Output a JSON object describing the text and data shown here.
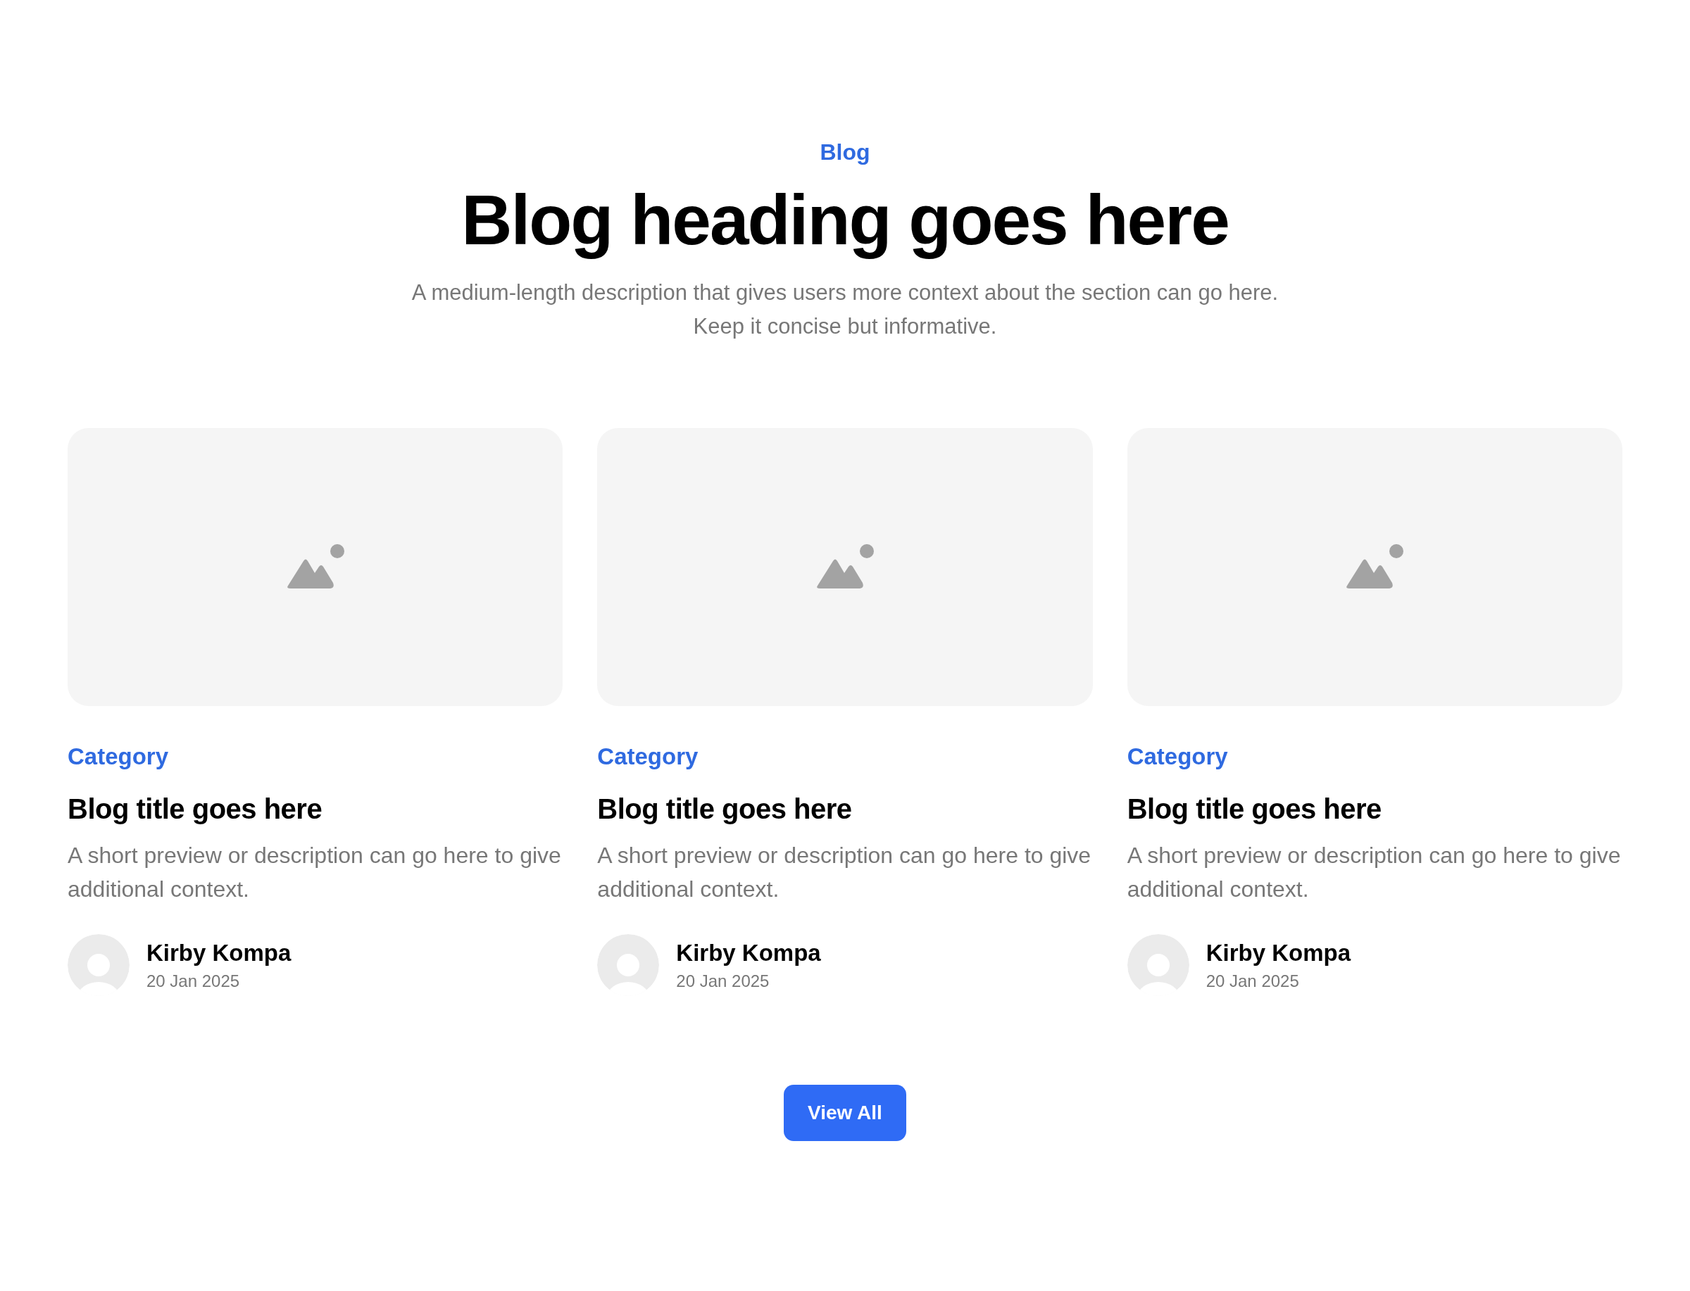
{
  "eyebrow": "Blog",
  "heading": "Blog heading goes here",
  "description": "A medium-length description that gives users more context about the section can go here. Keep it concise but informative.",
  "posts": [
    {
      "category": "Category",
      "title": "Blog title goes here",
      "preview": "A short preview or description can go here to give additional context.",
      "author": "Kirby Kompa",
      "date": "20 Jan 2025"
    },
    {
      "category": "Category",
      "title": "Blog title goes here",
      "preview": "A short preview or description can go here to give additional context.",
      "author": "Kirby Kompa",
      "date": "20 Jan 2025"
    },
    {
      "category": "Category",
      "title": "Blog title goes here",
      "preview": "A short preview or description can go here to give additional context.",
      "author": "Kirby Kompa",
      "date": "20 Jan 2025"
    }
  ],
  "button": "View All"
}
